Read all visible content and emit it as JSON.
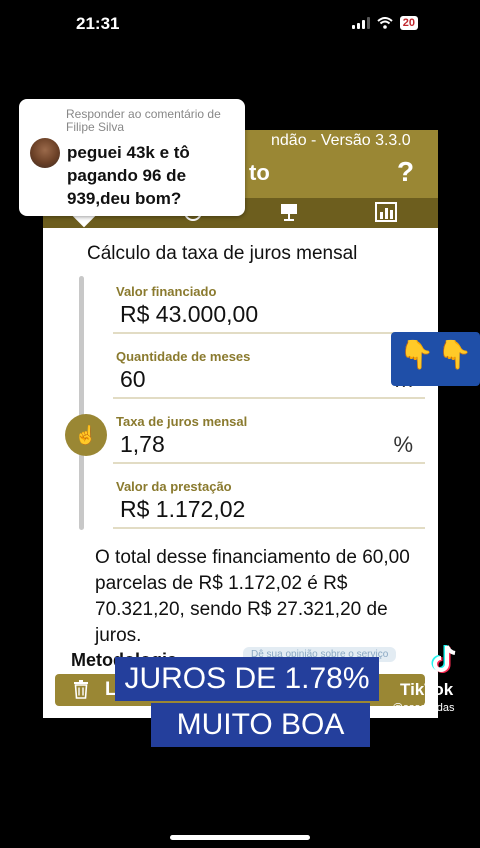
{
  "status_bar": {
    "time": "21:31",
    "battery": "20"
  },
  "app": {
    "version_text": "ndão - Versão 3.3.0",
    "title_fragment": "to",
    "help_icon": "?",
    "section_title": "Cálculo da taxa de juros mensal",
    "fields": [
      {
        "label": "Valor financiado",
        "value": "R$ 43.000,00",
        "unit": ""
      },
      {
        "label": "Quantidade de meses",
        "value": "60",
        "unit": "m"
      },
      {
        "label": "Taxa de juros mensal",
        "value": "1,78",
        "unit": "%"
      },
      {
        "label": "Valor da prestação",
        "value": "R$ 1.172,02",
        "unit": ""
      }
    ],
    "summary": "O total desse financiamento de 60,00 parcelas de R$ 1.172,02 é R$ 70.321,20, sendo R$ 27.321,20 de juros.",
    "methodology_label": "Metodologia",
    "methodology_chip": "Dê sua opinião sobre o serviço",
    "footer_label": "L",
    "icons": {
      "tab_1": "smile-icon",
      "tab_2": "presentation-icon",
      "tab_3": "bar-chart-icon",
      "slider_knob": "thumbs-up-icon",
      "footer": "trash-icon"
    },
    "accent_color": "#9a8734"
  },
  "comment": {
    "header": "Responder ao comentário de Filipe Silva",
    "text": "peguei 43k e tô pagando 96 de 939,deu bom?"
  },
  "overlay": {
    "caption_line1": "JUROS DE 1.78%",
    "caption_line2": "MUITO BOA",
    "emoji_badge": [
      "👇",
      "👇"
    ],
    "tiktok_wordmark": "TikTok",
    "tiktok_handle": "@sosdividas",
    "caption_color": "#243f9c"
  }
}
